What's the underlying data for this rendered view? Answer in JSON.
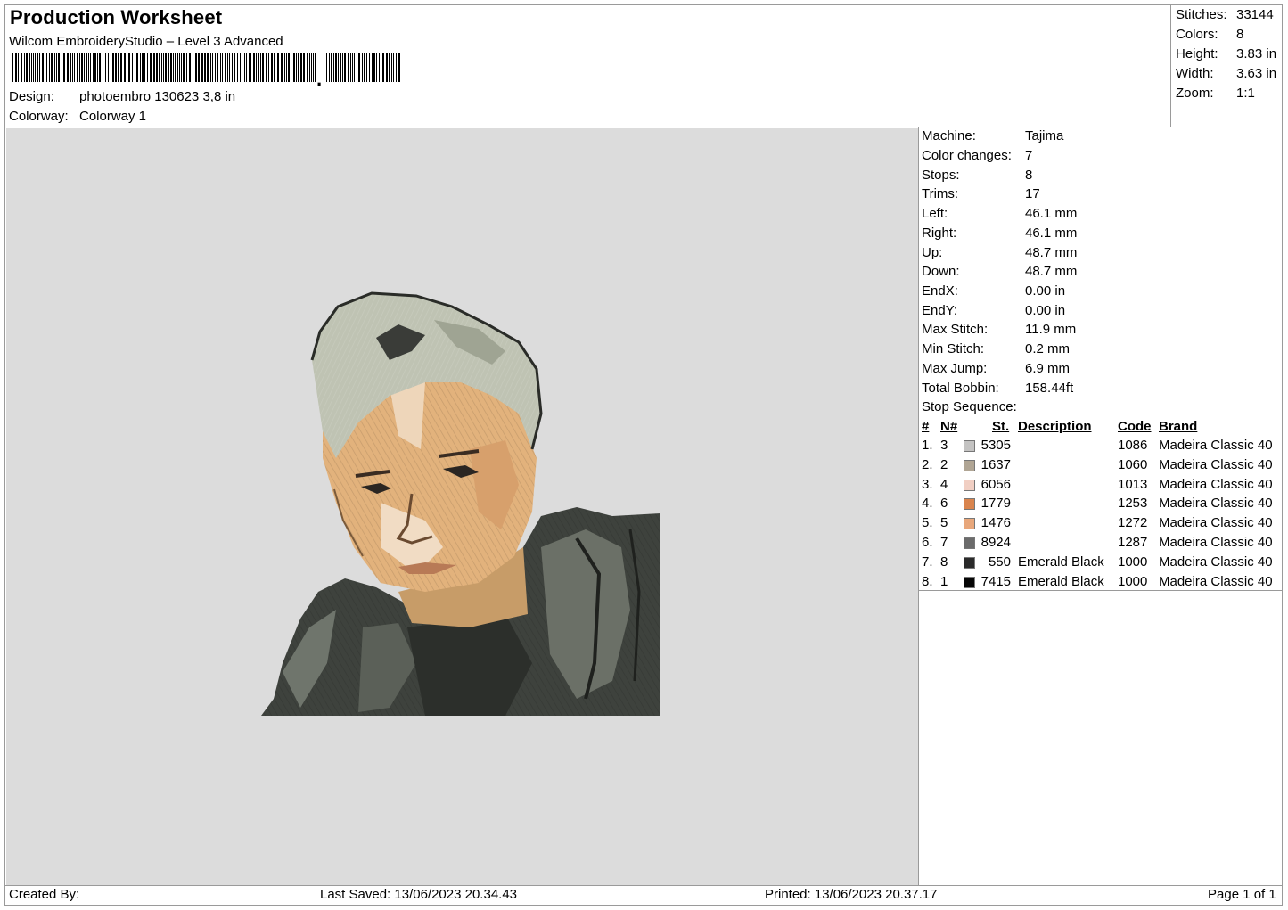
{
  "header": {
    "title": "Production Worksheet",
    "software": "Wilcom EmbroideryStudio – Level 3 Advanced",
    "design_label": "Design:",
    "design_value": "photoembro 130623 3,8 in",
    "colorway_label": "Colorway:",
    "colorway_value": "Colorway 1"
  },
  "stats": [
    {
      "label": "Stitches:",
      "value": "33144"
    },
    {
      "label": "Colors:",
      "value": "8"
    },
    {
      "label": "Height:",
      "value": "3.83 in"
    },
    {
      "label": "Width:",
      "value": "3.63 in"
    },
    {
      "label": "Zoom:",
      "value": "1:1"
    }
  ],
  "machine": [
    {
      "label": "Machine:",
      "value": "Tajima"
    },
    {
      "label": "Color changes:",
      "value": "7"
    },
    {
      "label": "Stops:",
      "value": "8"
    },
    {
      "label": "Trims:",
      "value": "17"
    },
    {
      "label": "Left:",
      "value": "46.1 mm"
    },
    {
      "label": "Right:",
      "value": "46.1 mm"
    },
    {
      "label": "Up:",
      "value": "48.7 mm"
    },
    {
      "label": "Down:",
      "value": "48.7 mm"
    },
    {
      "label": "EndX:",
      "value": "0.00 in"
    },
    {
      "label": "EndY:",
      "value": "0.00 in"
    },
    {
      "label": "Max Stitch:",
      "value": "11.9 mm"
    },
    {
      "label": "Min Stitch:",
      "value": "0.2 mm"
    },
    {
      "label": "Max Jump:",
      "value": "6.9 mm"
    },
    {
      "label": "Total Bobbin:",
      "value": "158.44ft"
    }
  ],
  "stop_sequence": {
    "title": "Stop Sequence:",
    "headers": {
      "num": "#",
      "n": "N#",
      "st": "St.",
      "description": "Description",
      "code": "Code",
      "brand": "Brand"
    },
    "rows": [
      {
        "num": "1.",
        "n": "3",
        "color": "#c4c3c2",
        "st": "5305",
        "description": "",
        "code": "1086",
        "brand": "Madeira Classic 40"
      },
      {
        "num": "2.",
        "n": "2",
        "color": "#b0a594",
        "st": "1637",
        "description": "",
        "code": "1060",
        "brand": "Madeira Classic 40"
      },
      {
        "num": "3.",
        "n": "4",
        "color": "#f1cfc3",
        "st": "6056",
        "description": "",
        "code": "1013",
        "brand": "Madeira Classic 40"
      },
      {
        "num": "4.",
        "n": "6",
        "color": "#d9844e",
        "st": "1779",
        "description": "",
        "code": "1253",
        "brand": "Madeira Classic 40"
      },
      {
        "num": "5.",
        "n": "5",
        "color": "#e8a77b",
        "st": "1476",
        "description": "",
        "code": "1272",
        "brand": "Madeira Classic 40"
      },
      {
        "num": "6.",
        "n": "7",
        "color": "#6b6b6b",
        "st": "8924",
        "description": "",
        "code": "1287",
        "brand": "Madeira Classic 40"
      },
      {
        "num": "7.",
        "n": "8",
        "color": "#2a2a2a",
        "st": "550",
        "description": "Emerald Black",
        "code": "1000",
        "brand": "Madeira Classic 40"
      },
      {
        "num": "8.",
        "n": "1",
        "color": "#050505",
        "st": "7415",
        "description": "Emerald Black",
        "code": "1000",
        "brand": "Madeira Classic 40"
      }
    ]
  },
  "footer": {
    "created_by": "Created By:",
    "last_saved": "Last Saved: 13/06/2023 20.34.43",
    "printed": "Printed: 13/06/2023 20.37.17",
    "page": "Page 1 of 1"
  },
  "preview": {
    "background_color": "#dcdcdc",
    "design_name": "embroidery-portrait"
  }
}
